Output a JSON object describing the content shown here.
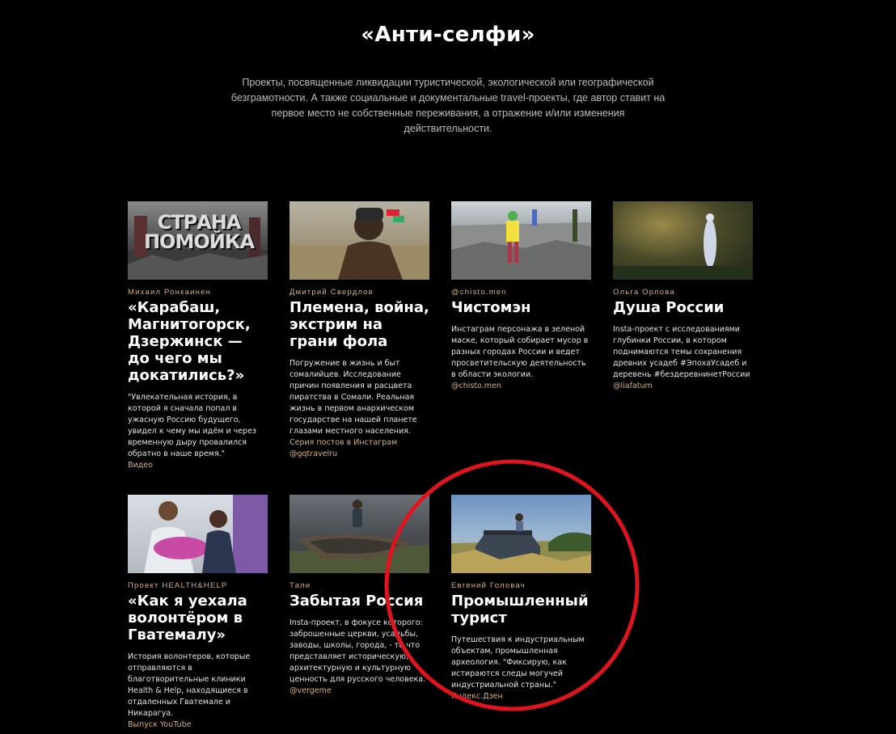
{
  "section": {
    "title": "«Анти-селфи»",
    "description": "Проекты, посвященные ликвидации туристической, экологической или географической безграмотности. А также социальные и документальные travel-проекты, где автор ставит на первое место не собственные переживания, а отражение и/или изменения действительности."
  },
  "cards": [
    {
      "author": "Михаил Ронкаинен",
      "title": "«Карабаш, Магнитогорск, Дзержинск — до чего мы докатились?»",
      "text": "\"Увлекательная история, в которой я сначала попал в ужасную Россию будущего, увидел к чему мы идём и через временную дыру провалился обратно в наше время.\"",
      "links": [
        "Видео"
      ],
      "image_text": "СТРАНА ПОМОЙКА"
    },
    {
      "author": "Дмитрий Свердлов",
      "title": "Племена, война, экстрим на грани фола",
      "text": "Погружение в жизнь и быт сомалийцев. Исследование причин появления и расцвета пиратства в Сомали. Реальная жизнь в первом анархическом государстве на нашей планете глазами местного населения.",
      "links": [
        "Серия постов в Инстаграм",
        "@gqtravelru"
      ]
    },
    {
      "author": "@chisto.men",
      "title": "Чистомэн",
      "text": "Инстаграм персонажа в зеленой маске, который собирает мусор в разных городах России и ведет просветительскую деятельность в области экологии.",
      "links": [
        "@chisto.men"
      ]
    },
    {
      "author": "Ольга Орлова",
      "title": "Душа России",
      "text": "Insta-проект с исследованиями глубинки России, в котором поднимаются темы сохранения древних усадеб #ЭпохаУсадеб и деревень #бездеревнинетРоссии",
      "links": [
        "@liafatum"
      ]
    },
    {
      "author": "Проект HEALTH&HELP",
      "title": "«Как я уехала волонтёром в Гватемалу»",
      "text": "История волонтеров, которые отправляются в благотворительные клиники Health & Help, находящиеся в отдаленных Гватемале и Никарагуа.",
      "links": [
        "Выпуск YouTube"
      ]
    },
    {
      "author": "Тали",
      "title": "Забытая Россия",
      "text": "Insta-проект, в фокусе которого: заброшенные церкви, усадьбы, заводы, школы, города, - то что представляет историческую, архитектурную и культурную ценность для русского человека.",
      "links": [
        "@vergeme"
      ]
    },
    {
      "author": "Евгений Головач",
      "title": "Промышленный турист",
      "text": "Путешествия к индустриальным объектам, промышленная археология. \"Фиксирую, как истираются следы могучей индустриальной страны.\"",
      "links": [
        "Яндекс.Дзен"
      ]
    }
  ],
  "colors": {
    "background": "#000000",
    "accent": "#d9b27a",
    "annotation": "#e0141e"
  }
}
